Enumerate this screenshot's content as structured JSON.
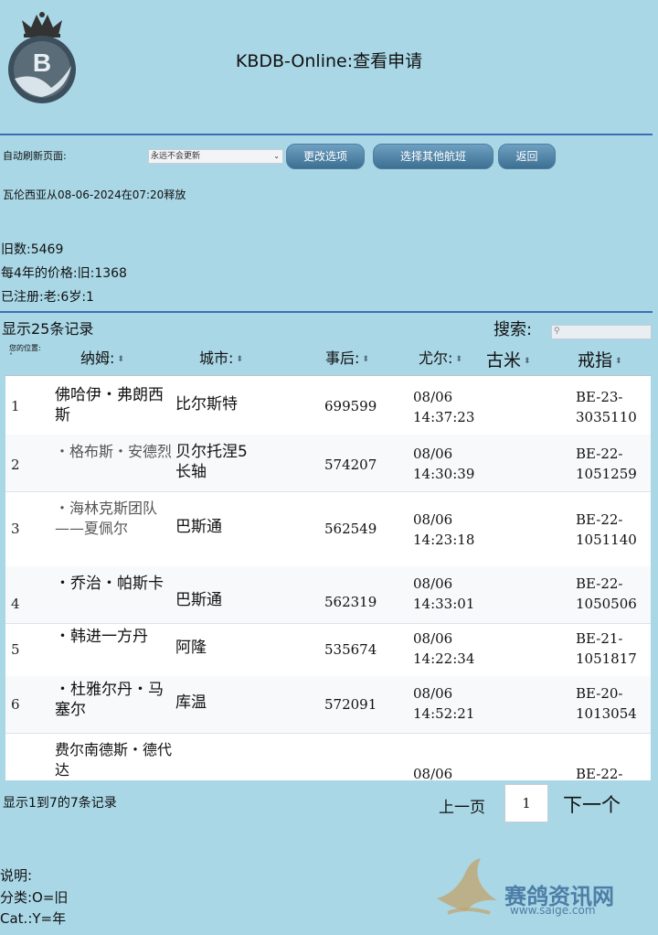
{
  "header": {
    "title": "KBDB-Online:查看申请"
  },
  "toolbar": {
    "refresh_label": "自动刷新页面:",
    "refresh_selected": "永远不会更新",
    "options_button": "更改选项",
    "flight_button": "选择其他航班",
    "back_button": "返回"
  },
  "release_info": "瓦伦西亚从08-06-2024在07:20释放",
  "stats": {
    "old_count": "旧数:5469",
    "price": "每4年的价格:旧:1368",
    "registered": "已注册:老:6岁:1"
  },
  "records_shown": "显示25条记录",
  "search": {
    "label": "搜索:"
  },
  "table": {
    "columns": {
      "position": "您的位置:",
      "name": "纳姆:",
      "city": "城市:",
      "after": "事后:",
      "yuer": "尤尔:",
      "gumi": "古米",
      "ring": "戒指"
    },
    "rows": [
      {
        "num": "1",
        "name": "佛哈伊・弗朗西斯",
        "city": "比尔斯特",
        "id": "699599",
        "date": "08/06",
        "time": "14:37:23",
        "ring1": "BE-23-",
        "ring2": "3035110"
      },
      {
        "num": "2",
        "name": "・格布斯・安德烈",
        "city": "贝尔托涅5长轴",
        "id": "574207",
        "date": "08/06",
        "time": "14:30:39",
        "ring1": "BE-22-",
        "ring2": "1051259"
      },
      {
        "num": "3",
        "name": "・海林克斯团队——夏佩尔",
        "city": "巴斯通",
        "id": "562549",
        "date": "08/06",
        "time": "14:23:18",
        "ring1": "BE-22-",
        "ring2": "1051140"
      },
      {
        "num": "4",
        "name": "・乔治・帕斯卡",
        "city": "巴斯通",
        "id": "562319",
        "date": "08/06",
        "time": "14:33:01",
        "ring1": "BE-22-",
        "ring2": "1050506"
      },
      {
        "num": "5",
        "name": "・韩进一方丹",
        "city": "阿隆",
        "id": "535674",
        "date": "08/06",
        "time": "14:22:34",
        "ring1": "BE-21-",
        "ring2": "1051817"
      },
      {
        "num": "6",
        "name": "・杜雅尔丹・马塞尔",
        "city": "库温",
        "id": "572091",
        "date": "08/06",
        "time": "14:52:21",
        "ring1": "BE-20-",
        "ring2": "1013054"
      },
      {
        "num": "",
        "name": "费尔南德斯・德代达",
        "city": "",
        "id": "",
        "date": "08/06",
        "time": "",
        "ring1": "BE-22-",
        "ring2": ""
      }
    ]
  },
  "pagination": {
    "info": "显示1到7的7条记录",
    "prev": "上一页",
    "current": "1",
    "next": "下一个"
  },
  "legend": {
    "title": "说明:",
    "category": "分类:O=旧",
    "cat": "Cat.:Y=年"
  },
  "watermark": {
    "name": "赛鸽资讯网",
    "url": "www.saige.com"
  }
}
